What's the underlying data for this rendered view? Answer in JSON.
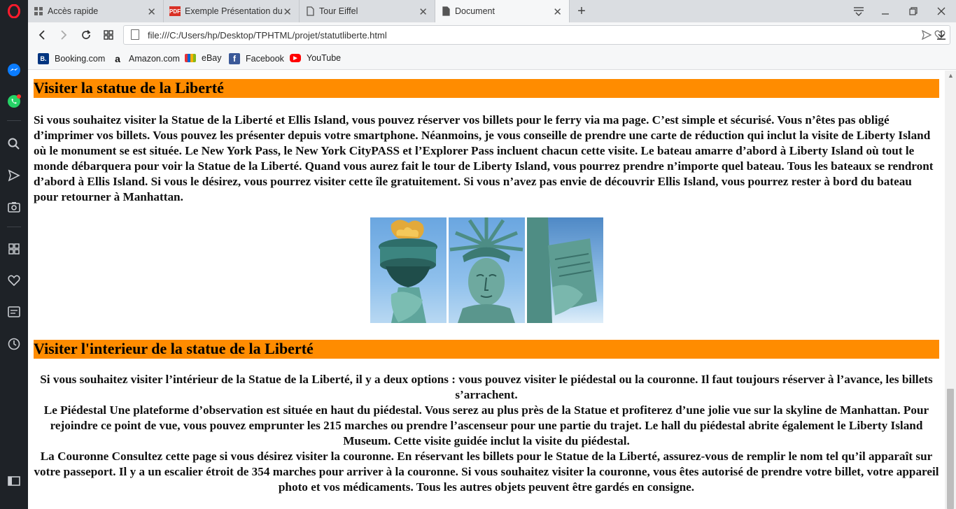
{
  "browser": {
    "tabs": [
      {
        "title": "Accès rapide",
        "icon": "grid-icon"
      },
      {
        "title": "Exemple Présentation du p",
        "icon": "pdf-icon"
      },
      {
        "title": "Tour Eiffel",
        "icon": "document-icon"
      },
      {
        "title": "Document",
        "icon": "document-icon"
      }
    ],
    "url": "file:///C:/Users/hp/Desktop/TPHTML/projet/statutliberte.html",
    "bookmarks": [
      {
        "label": "Booking.com",
        "icon_letter": "B.",
        "color": "#003580"
      },
      {
        "label": "Amazon.com",
        "icon_letter": "a",
        "color": "#ffffff"
      },
      {
        "label": "eBay",
        "icon_letter": "",
        "color": "#e53238"
      },
      {
        "label": "Facebook",
        "icon_letter": "f",
        "color": "#3b5998"
      },
      {
        "label": "YouTube",
        "icon_letter": "▶",
        "color": "#ff0000"
      }
    ],
    "accent": "#ff8c00"
  },
  "page": {
    "section1": {
      "heading": "Visiter la statue de la Liberté",
      "text": "Si vous souhaitez visiter la Statue de la Liberté et Ellis Island, vous pouvez réserver vos billets pour le ferry via ma page. C’est simple et sécurisé. Vous n’êtes pas obligé d’imprimer vos billets. Vous pouvez les présenter depuis votre smartphone. Néanmoins, je vous conseille de prendre une carte de réduction qui inclut la visite de Liberty Island où le monument se est située. Le New York Pass, le New York CityPASS et l’Explorer Pass incluent chacun cette visite. Le bateau amarre d’abord à Liberty Island où tout le monde débarquera pour voir la Statue de la Liberté. Quand vous aurez fait le tour de Liberty Island, vous pourrez prendre n’importe quel bateau. Tous les bateaux se rendront d’abord à Ellis Island. Si vous le désirez, vous pourrez visiter cette île gratuitement. Si vous n’avez pas envie de découvrir Ellis Island, vous pourrez rester à bord du bateau pour retourner à Manhattan."
    },
    "section2": {
      "heading": "Visiter l'interieur de la statue de la Liberté",
      "line1": "Si vous souhaitez visiter l’intérieur de la Statue de la Liberté, il y a deux options : vous pouvez visiter le piédestal ou la couronne. Il faut toujours réserver à l’avance, les billets s’arrachent.",
      "line2": "Le Piédestal Une plateforme d’observation est située en haut du piédestal. Vous serez au plus près de la Statue et profiterez d’une jolie vue sur la skyline de Manhattan. Pour rejoindre ce point de vue, vous pouvez emprunter les 215 marches ou prendre l’ascenseur pour une partie du trajet. Le hall du piédestal abrite également le Liberty Island Museum. Cette visite guidée inclut la visite du piédestal.",
      "line3": "La Couronne Consultez cette page si vous désirez visiter la couronne. En réservant les billets pour le Statue de la Liberté, assurez-vous de remplir le nom tel qu’il apparaît sur votre passeport. Il y a un escalier étroit de 354 marches pour arriver à la couronne. Si vous souhaitez visiter la couronne, vous êtes autorisé de prendre votre billet, votre appareil photo et vos médicaments. Tous les autres objets peuvent être gardés en consigne."
    }
  }
}
